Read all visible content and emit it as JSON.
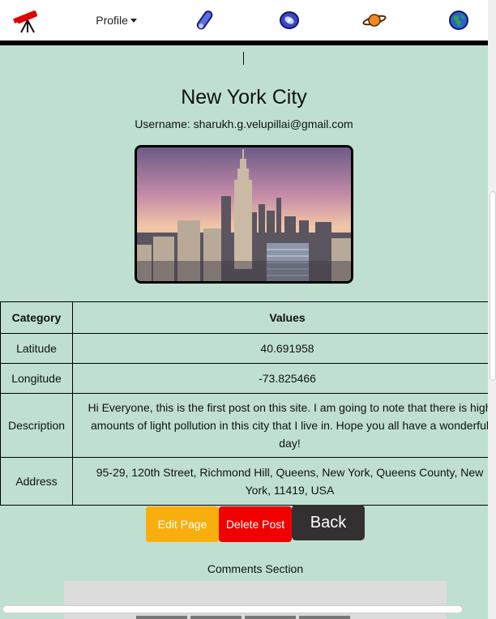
{
  "navbar": {
    "logo_icon": "telescope-icon",
    "profile_label": "Profile",
    "icons": [
      "comet-icon",
      "galaxy-icon",
      "planet-icon",
      "globe-icon"
    ]
  },
  "post": {
    "title": "New York City",
    "username": "Username: sharukh.g.velupillai@gmail.com",
    "image_icon": "city-skyline-photo"
  },
  "table": {
    "headers": [
      "Category",
      "Values"
    ],
    "rows": [
      {
        "category": "Latitude",
        "value": "40.691958"
      },
      {
        "category": "Longitude",
        "value": "-73.825466"
      },
      {
        "category": "Description",
        "value": "Hi Everyone, this is the first post on this site. I am going to note that there is high amounts of light pollution in this city that I live in. Hope you all have a wonderful day!"
      },
      {
        "category": "Address",
        "value": "95-29, 120th Street, Richmond Hill, Queens, New York, Queens County, New York, 11419, USA"
      }
    ]
  },
  "actions": {
    "edit_label": "Edit Page",
    "delete_label": "Delete Post",
    "back_label": "Back"
  },
  "comments": {
    "label": "Comments Section"
  },
  "colors": {
    "background": "#bfe0d1",
    "edit": "#f9ae0d",
    "delete": "#f00000",
    "back": "#333031"
  }
}
